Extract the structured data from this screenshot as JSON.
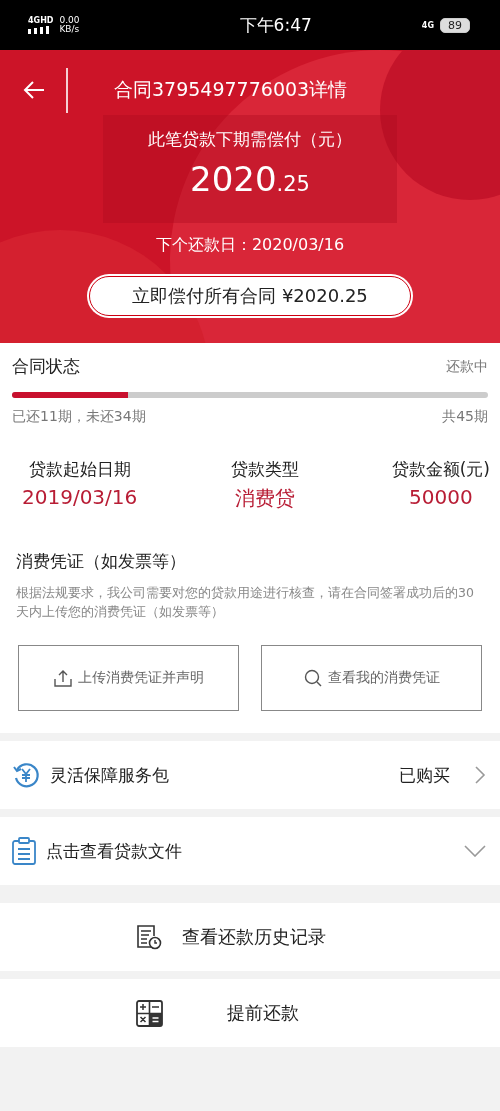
{
  "status_bar": {
    "network": "4GHD",
    "speed": "0.00",
    "speed_unit": "KB/s",
    "time": "下午6:47",
    "network_right": "4G",
    "battery": "89"
  },
  "header": {
    "title": "合同3795497776003详情",
    "due_label": "此笔贷款下期需偿付（元）",
    "amount_integer": "2020",
    "amount_decimal": ".25",
    "next_date": "下个还款日：2020/03/16",
    "pay_all_button": "立即偿付所有合同 ¥2020.25"
  },
  "contract_status": {
    "title": "合同状态",
    "status": "还款中",
    "level": 0.244,
    "progress_text": "已还11期，未还34期",
    "total": "共45期"
  },
  "loan_info": [
    {
      "label": "贷款起始日期",
      "value": "2019/03/16"
    },
    {
      "label": "贷款类型",
      "value": "消费贷"
    },
    {
      "label": "贷款金额(元)",
      "value": "50000"
    }
  ],
  "voucher": {
    "title": "消费凭证（如发票等）",
    "description": "根据法规要求，我公司需要对您的贷款用途进行核查，请在合同签署成功后的30 天内上传您的消费凭证（如发票等）",
    "buttons": [
      {
        "kind": "upload",
        "label": "上传消费凭证并声明"
      },
      {
        "kind": "search",
        "label": "查看我的消费凭证"
      }
    ]
  },
  "list_rows": [
    {
      "kind": "service",
      "label": "灵活保障服务包",
      "value": "已购买"
    },
    {
      "kind": "documents",
      "label": "点击查看贷款文件",
      "expanded": false
    }
  ],
  "actions": [
    {
      "kind": "history",
      "label": "查看还款历史记录"
    },
    {
      "kind": "calculator",
      "label": "提前还款"
    }
  ]
}
